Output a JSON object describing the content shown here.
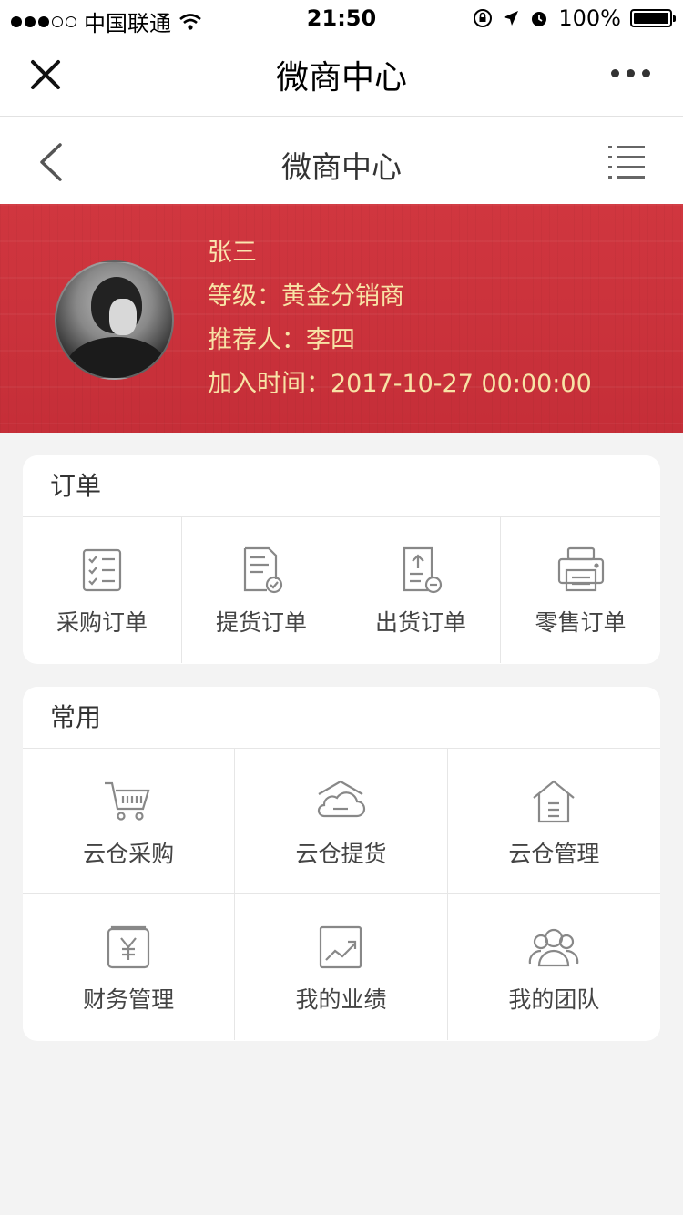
{
  "status_bar": {
    "carrier": "中国联通",
    "time": "21:50",
    "battery": "100%",
    "signal_icon": "signal-dots-icon",
    "wifi_icon": "wifi-icon"
  },
  "wechat_bar": {
    "title": "微商中心"
  },
  "nav_bar": {
    "title": "微商中心"
  },
  "profile": {
    "name": "张三",
    "level": "等级：黄金分销商",
    "referrer": "推荐人：李四",
    "join_time": "加入时间：2017-10-27   00:00:00"
  },
  "orders": {
    "title": "订单",
    "items": [
      {
        "label": "采购订单",
        "icon": "checklist-icon"
      },
      {
        "label": "提货订单",
        "icon": "document-check-icon"
      },
      {
        "label": "出货订单",
        "icon": "document-upload-icon"
      },
      {
        "label": "零售订单",
        "icon": "printer-icon"
      }
    ]
  },
  "common": {
    "title": "常用",
    "items": [
      {
        "label": "云仓采购",
        "icon": "cart-icon"
      },
      {
        "label": "云仓提货",
        "icon": "cloud-warehouse-icon"
      },
      {
        "label": "云仓管理",
        "icon": "house-icon"
      },
      {
        "label": "财务管理",
        "icon": "yen-wallet-icon"
      },
      {
        "label": "我的业绩",
        "icon": "trend-chart-icon"
      },
      {
        "label": "我的团队",
        "icon": "team-icon"
      }
    ]
  },
  "colors": {
    "header_red": "#c9303b",
    "profile_text": "#f8e3a6",
    "background": "#f3f3f3"
  }
}
